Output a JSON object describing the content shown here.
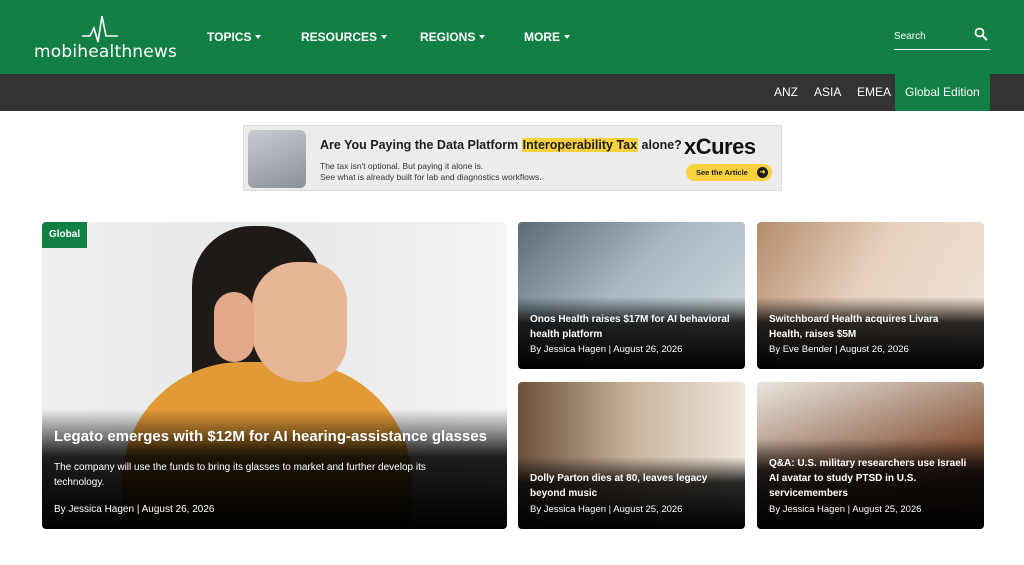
{
  "header": {
    "logo_text": "mobihealthnews",
    "nav": [
      {
        "label": "TOPICS"
      },
      {
        "label": "RESOURCES"
      },
      {
        "label": "REGIONS"
      },
      {
        "label": "MORE"
      }
    ],
    "search_placeholder": "Search"
  },
  "editions": [
    "ANZ",
    "ASIA",
    "EMEA",
    "Global Edition"
  ],
  "ad": {
    "headline_pre": "Are You Paying the Data Platform ",
    "headline_highlight": "Interoperability Tax",
    "headline_post": " alone?",
    "sub1": "The tax isn't optional. But paying it alone is.",
    "sub2": "See what is already built for lab and diagnostics workflows.",
    "brand": "xCures",
    "cta": "See the Article"
  },
  "feature": {
    "badge": "Global",
    "title": "Legato emerges with $12M for AI hearing-assistance glasses",
    "excerpt": "The company will use the funds to bring its glasses to market and further develop its technology.",
    "byline": "By Jessica Hagen  |  August 26, 2026"
  },
  "cards": [
    {
      "title": "Onos Health raises $17M for AI behavioral health platform",
      "byline": "By Jessica Hagen  |  August 26, 2026"
    },
    {
      "title": "Switchboard Health acquires Livara Health, raises $5M",
      "byline": "By Eve Bender  |  August 26, 2026"
    },
    {
      "title": "Dolly Parton dies at 80, leaves legacy beyond music",
      "byline": "By Jessica Hagen  |  August 25, 2026"
    },
    {
      "title": "Q&A: U.S. military researchers use Israeli AI avatar to study PTSD in U.S. servicemembers",
      "byline": "By Jessica Hagen  |  August 25, 2026"
    }
  ],
  "colors": {
    "brand_green": "#127f45",
    "edition_bar": "#333333",
    "ad_highlight": "#f7d23e"
  }
}
